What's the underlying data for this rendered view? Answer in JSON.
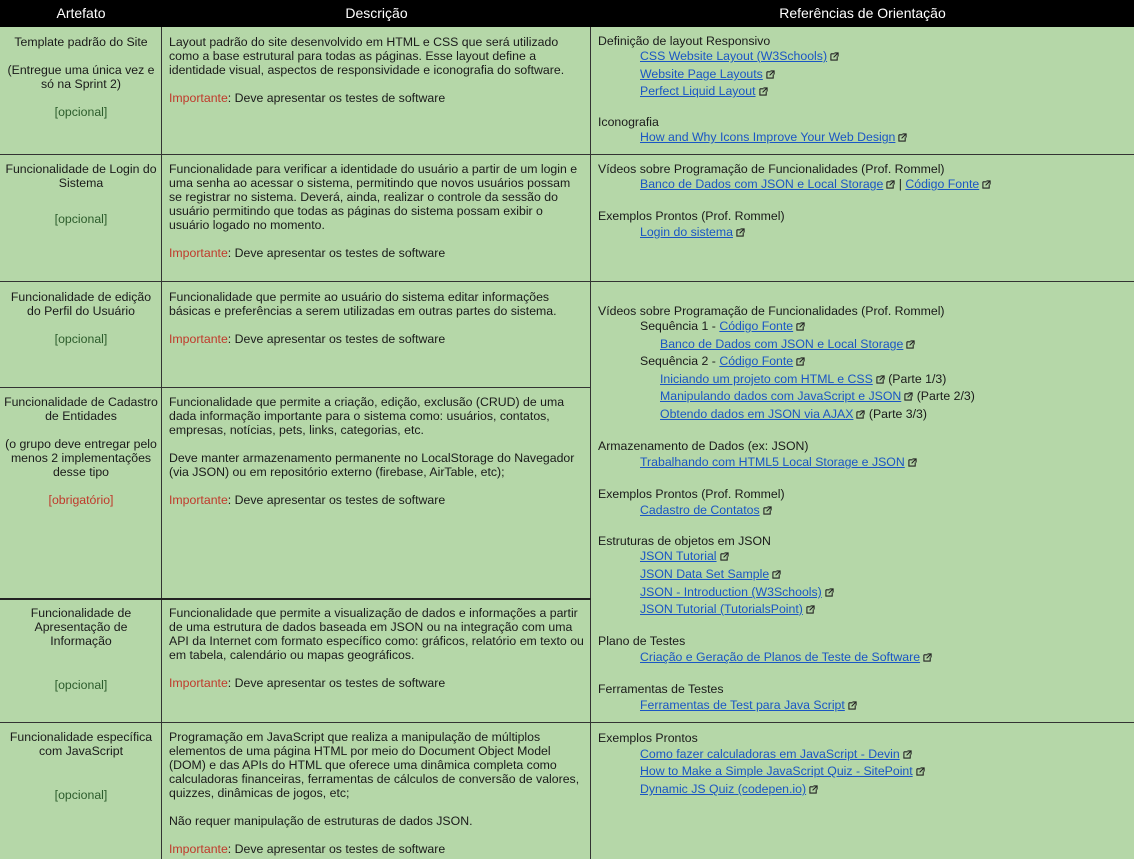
{
  "header": {
    "col1": "Artefato",
    "col2": "Descrição",
    "col3": "Referências de Orientação"
  },
  "common": {
    "important_label": "Importante",
    "important_text": ": Deve apresentar os testes de software",
    "optional": "[opcional]",
    "mandatory": "[obrigatório]"
  },
  "rows": [
    {
      "title": "Template padrão do Site",
      "note": "(Entregue uma única vez e só na Sprint 2)",
      "desc": "Layout padrão do site desenvolvido em HTML e CSS que será utilizado como a base estrutural para todas as páginas. Esse layout define a identidade visual, aspectos de responsividade e iconografia do software."
    },
    {
      "title": "Funcionalidade de Login do Sistema",
      "desc": "Funcionalidade para verificar a identidade do usuário a partir de um login e uma senha ao acessar o sistema, permitindo que novos usuários possam se registrar no sistema. Deverá, ainda, realizar o controle da sessão do usuário permitindo que todas as páginas do sistema possam exibir o usuário logado no momento."
    },
    {
      "title": "Funcionalidade de edição do Perfil do Usuário",
      "desc": "Funcionalidade que permite ao usuário do sistema editar informações básicas e preferências a serem utilizadas em outras partes do sistema."
    },
    {
      "title": "Funcionalidade de Cadastro de Entidades",
      "note": "(o grupo deve entregar pelo menos 2 implementações desse tipo",
      "desc": "Funcionalidade que permite a criação, edição, exclusão (CRUD) de uma dada informação importante para o sistema como: usuários, contatos, empresas, notícias, pets, links, categorias, etc.",
      "desc2": "Deve manter armazenamento permanente no LocalStorage do Navegador (via JSON) ou em repositório externo (firebase, AirTable, etc);"
    },
    {
      "title": "Funcionalidade de Apresentação de Informação",
      "desc": "Funcionalidade que permite a visualização de dados e informações a partir de uma estrutura de dados baseada em JSON ou na integração com uma API da Internet com formato específico como: gráficos, relatório em texto ou em tabela, calendário ou mapas geográficos."
    },
    {
      "title": "Funcionalidade específica com JavaScript",
      "desc": "Programação em JavaScript que realiza a manipulação de múltiplos elementos de uma página HTML por meio do Document Object Model (DOM) e das APIs do HTML que oferece uma dinâmica completa como calculadoras financeiras, ferramentas de cálculos de conversão de valores, quizzes, dinâmicas de jogos, etc;",
      "desc2": "Não requer manipulação de estruturas de dados JSON."
    }
  ],
  "refs": {
    "r1_head1": "Definição de layout Responsivo",
    "r1_l1": "CSS Website Layout (W3Schools)",
    "r1_l2": "Website Page Layouts",
    "r1_l3": "Perfect Liquid Layout",
    "r1_head2": "Iconografia",
    "r1_l4": "How and Why Icons Improve Your Web Design",
    "r2_head1": "Vídeos sobre Programação de Funcionalidades (Prof. Rommel)",
    "r2_l1": "Banco de Dados com JSON e Local Storage",
    "r2_sep": " | ",
    "r2_l2": "Código Fonte",
    "r2_head2": "Exemplos Prontos (Prof. Rommel)",
    "r2_l3": "Login do sistema",
    "r3_head1": "Vídeos sobre Programação de Funcionalidades (Prof. Rommel)",
    "r3_seq1": "Sequência 1 - ",
    "r3_seq1_link": "Código Fonte",
    "r3_l1": "Banco de Dados com JSON e Local Storage",
    "r3_seq2": "Sequência 2 - ",
    "r3_seq2_link": "Código Fonte",
    "r3_l2": "Iniciando um projeto com HTML e CSS",
    "r3_l2_part": " (Parte 1/3)",
    "r3_l3": "Manipulando dados com JavaScript e JSON",
    "r3_l3_part": " (Parte 2/3)",
    "r3_l4": "Obtendo dados em JSON via AJAX",
    "r3_l4_part": " (Parte 3/3)",
    "r3_head2": "Armazenamento de Dados (ex: JSON)",
    "r3_l5": "Trabalhando com HTML5 Local Storage e JSON",
    "r3_head3": "Exemplos Prontos (Prof. Rommel)",
    "r3_l6": "Cadastro de Contatos",
    "r3_head4": "Estruturas de objetos em JSON",
    "r3_l7": "JSON Tutorial",
    "r3_l8": "JSON Data Set Sample",
    "r3_l9": "JSON - Introduction (W3Schools)",
    "r3_l10": "JSON Tutorial (TutorialsPoint)",
    "r3_head5": "Plano de Testes",
    "r3_l11": "Criação e Geração de Planos de Teste de Software",
    "r3_head6": "Ferramentas de Testes",
    "r3_l12": "Ferramentas de Test para Java Script",
    "r4_head1": "Exemplos Prontos",
    "r4_l1": "Como fazer calculadoras em JavaScript - Devin",
    "r4_l2": "How to Make a Simple JavaScript Quiz - SitePoint",
    "r4_l3": "Dynamic JS Quiz (codepen.io)"
  }
}
